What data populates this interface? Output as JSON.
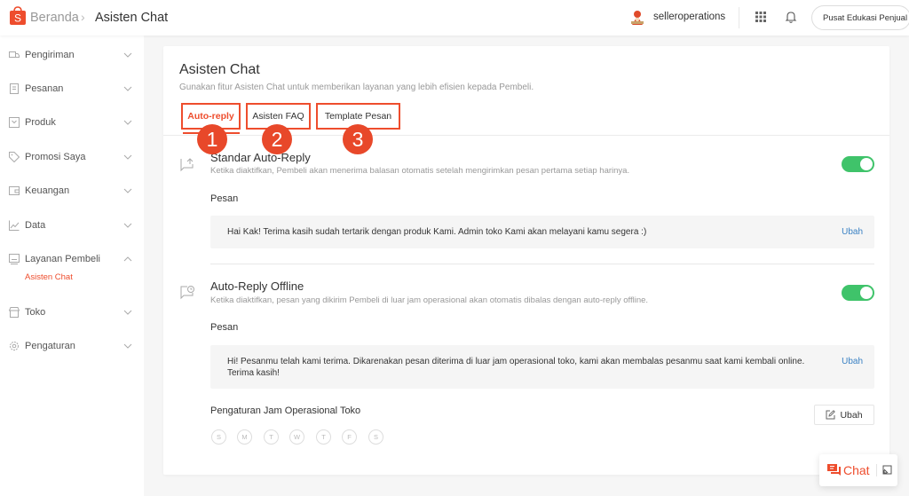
{
  "header": {
    "breadcrumb_home": "Beranda",
    "breadcrumb_sep": "›",
    "breadcrumb_current": "Asisten Chat",
    "username": "selleroperations",
    "edu_button": "Pusat Edukasi Penjual",
    "logo_letter": "S",
    "brand_color": "#ee4d2d"
  },
  "sidebar": {
    "items": [
      {
        "label": "Pengiriman",
        "icon": "truck-icon",
        "expanded": false
      },
      {
        "label": "Pesanan",
        "icon": "clipboard-icon",
        "expanded": false
      },
      {
        "label": "Produk",
        "icon": "box-icon",
        "expanded": false
      },
      {
        "label": "Promosi Saya",
        "icon": "tag-icon",
        "expanded": false
      },
      {
        "label": "Keuangan",
        "icon": "wallet-icon",
        "expanded": false
      },
      {
        "label": "Data",
        "icon": "chart-icon",
        "expanded": false
      },
      {
        "label": "Layanan Pembeli",
        "icon": "message-icon",
        "expanded": true
      },
      {
        "label": "Toko",
        "icon": "store-icon",
        "expanded": false
      },
      {
        "label": "Pengaturan",
        "icon": "gear-icon",
        "expanded": false
      }
    ],
    "active_sub": "Asisten Chat"
  },
  "main": {
    "title": "Asisten Chat",
    "subtitle": "Gunakan fitur Asisten Chat untuk memberikan layanan yang lebih efisien kepada Pembeli.",
    "tabs": [
      {
        "label": "Auto-reply",
        "active": true,
        "badge": "1"
      },
      {
        "label": "Asisten FAQ",
        "active": false,
        "badge": "2"
      },
      {
        "label": "Template Pesan",
        "active": false,
        "badge": "3"
      }
    ],
    "sections": [
      {
        "title": "Standar Auto-Reply",
        "description": "Ketika diaktifkan, Pembeli akan menerima balasan otomatis setelah mengirimkan pesan pertama setiap harinya.",
        "enabled": true,
        "message_label": "Pesan",
        "message": "Hai Kak! Terima kasih sudah tertarik dengan produk Kami. Admin toko Kami akan melayani kamu segera :)",
        "edit_label": "Ubah"
      },
      {
        "title": "Auto-Reply Offline",
        "description": "Ketika diaktifkan, pesan yang dikirim Pembeli di luar jam operasional akan otomatis dibalas dengan auto-reply offline.",
        "enabled": true,
        "message_label": "Pesan",
        "message": "Hi! Pesanmu telah kami terima. Dikarenakan pesan diterima di luar jam operasional toko, kami akan membalas pesanmu saat kami kembali online. Terima kasih!",
        "edit_label": "Ubah"
      }
    ],
    "hours": {
      "title": "Pengaturan Jam Operasional Toko",
      "days": [
        "S",
        "M",
        "T",
        "W",
        "T",
        "F",
        "S"
      ],
      "edit_button": "Ubah"
    },
    "toggle_color": "#3fc36a",
    "link_color": "#3b82c4"
  },
  "chat_widget": {
    "label": "Chat"
  }
}
